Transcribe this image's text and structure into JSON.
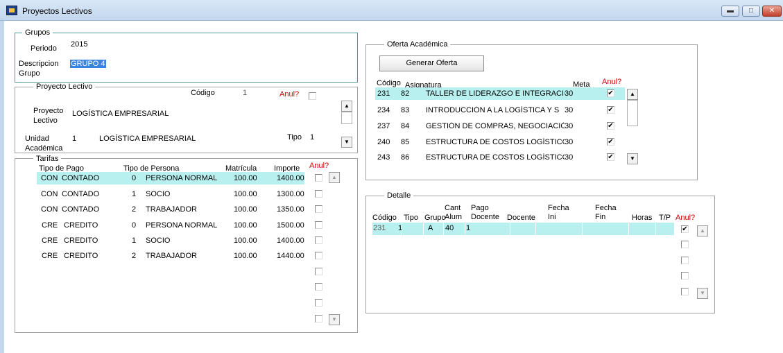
{
  "window": {
    "title": "Proyectos Lectivos"
  },
  "grupos": {
    "legend": "Grupos",
    "periodo_label": "Periodo",
    "periodo_value": "2015",
    "descripcion_label_1": "Descripcion",
    "descripcion_label_2": "Grupo",
    "descripcion_value": "GRUPO 4"
  },
  "proyecto": {
    "legend": "Proyecto Lectivo",
    "codigo_label": "Código",
    "codigo_value": "1",
    "anul_label": "Anul?",
    "proyecto_label_1": "Proyecto",
    "proyecto_label_2": "Lectivo",
    "proyecto_value": "LOGÍSTICA EMPRESARIAL",
    "unidad_label_1": "Unidad",
    "unidad_label_2": "Académica",
    "unidad_code": "1",
    "unidad_value": "LOGÍSTICA EMPRESARIAL",
    "tipo_label": "Tipo",
    "tipo_value": "1"
  },
  "tarifas": {
    "legend": "Tarifas",
    "headers": {
      "tipo_pago": "Tipo de Pago",
      "tipo_persona": "Tipo de Persona",
      "matricula": "Matrícula",
      "importe": "Importe",
      "anul": "Anul?"
    },
    "rows": [
      {
        "cod": "CON",
        "pago": "CONTADO",
        "n": "0",
        "persona": "PERSONA NORMAL",
        "matricula": "100.00",
        "importe": "1400.00"
      },
      {
        "cod": "CON",
        "pago": "CONTADO",
        "n": "1",
        "persona": "SOCIO",
        "matricula": "100.00",
        "importe": "1300.00"
      },
      {
        "cod": "CON",
        "pago": "CONTADO",
        "n": "2",
        "persona": "TRABAJADOR",
        "matricula": "100.00",
        "importe": "1350.00"
      },
      {
        "cod": "CRE",
        "pago": "CREDITO",
        "n": "0",
        "persona": "PERSONA NORMAL",
        "matricula": "100.00",
        "importe": "1500.00"
      },
      {
        "cod": "CRE",
        "pago": "CREDITO",
        "n": "1",
        "persona": "SOCIO",
        "matricula": "100.00",
        "importe": "1400.00"
      },
      {
        "cod": "CRE",
        "pago": "CREDITO",
        "n": "2",
        "persona": "TRABAJADOR",
        "matricula": "100.00",
        "importe": "1440.00"
      }
    ]
  },
  "oferta": {
    "legend": "Oferta Académica",
    "generar_button": "Generar Oferta",
    "headers": {
      "codigo": "Código",
      "asignatura": "Asignatura",
      "meta": "Meta",
      "anul": "Anul?"
    },
    "rows": [
      {
        "codigo": "231",
        "num": "82",
        "asignatura": "TALLER DE LIDERAZGO E INTEGRACIÓ",
        "meta": "30"
      },
      {
        "codigo": "234",
        "num": "83",
        "asignatura": "INTRODUCCIÓN A LA LOGÍSTICA Y S",
        "meta": "30"
      },
      {
        "codigo": "237",
        "num": "84",
        "asignatura": "GESTIÓN DE COMPRAS, NEGOCIACIÓ",
        "meta": "30"
      },
      {
        "codigo": "240",
        "num": "85",
        "asignatura": "ESTRUCTURA DE COSTOS LOGÍSTICO",
        "meta": "30"
      },
      {
        "codigo": "243",
        "num": "86",
        "asignatura": "ESTRUCTURA DE COSTOS LOGÍSTICO",
        "meta": "30"
      }
    ]
  },
  "detalle": {
    "legend": "Detalle",
    "headers": {
      "codigo": "Código",
      "tipo": "Tipo",
      "grupo": "Grupo",
      "cant_1": "Cant",
      "cant_2": "Alum",
      "pago_1": "Pago",
      "pago_2": "Docente",
      "docente": "Docente",
      "fini_1": "Fecha",
      "fini_2": "Ini",
      "ffin_1": "Fecha",
      "ffin_2": "Fin",
      "horas": "Horas",
      "tp": "T/P",
      "anul": "Anul?"
    },
    "row": {
      "codigo": "231",
      "tipo": "1",
      "grupo": "A",
      "cant": "40",
      "pago": "1"
    }
  }
}
